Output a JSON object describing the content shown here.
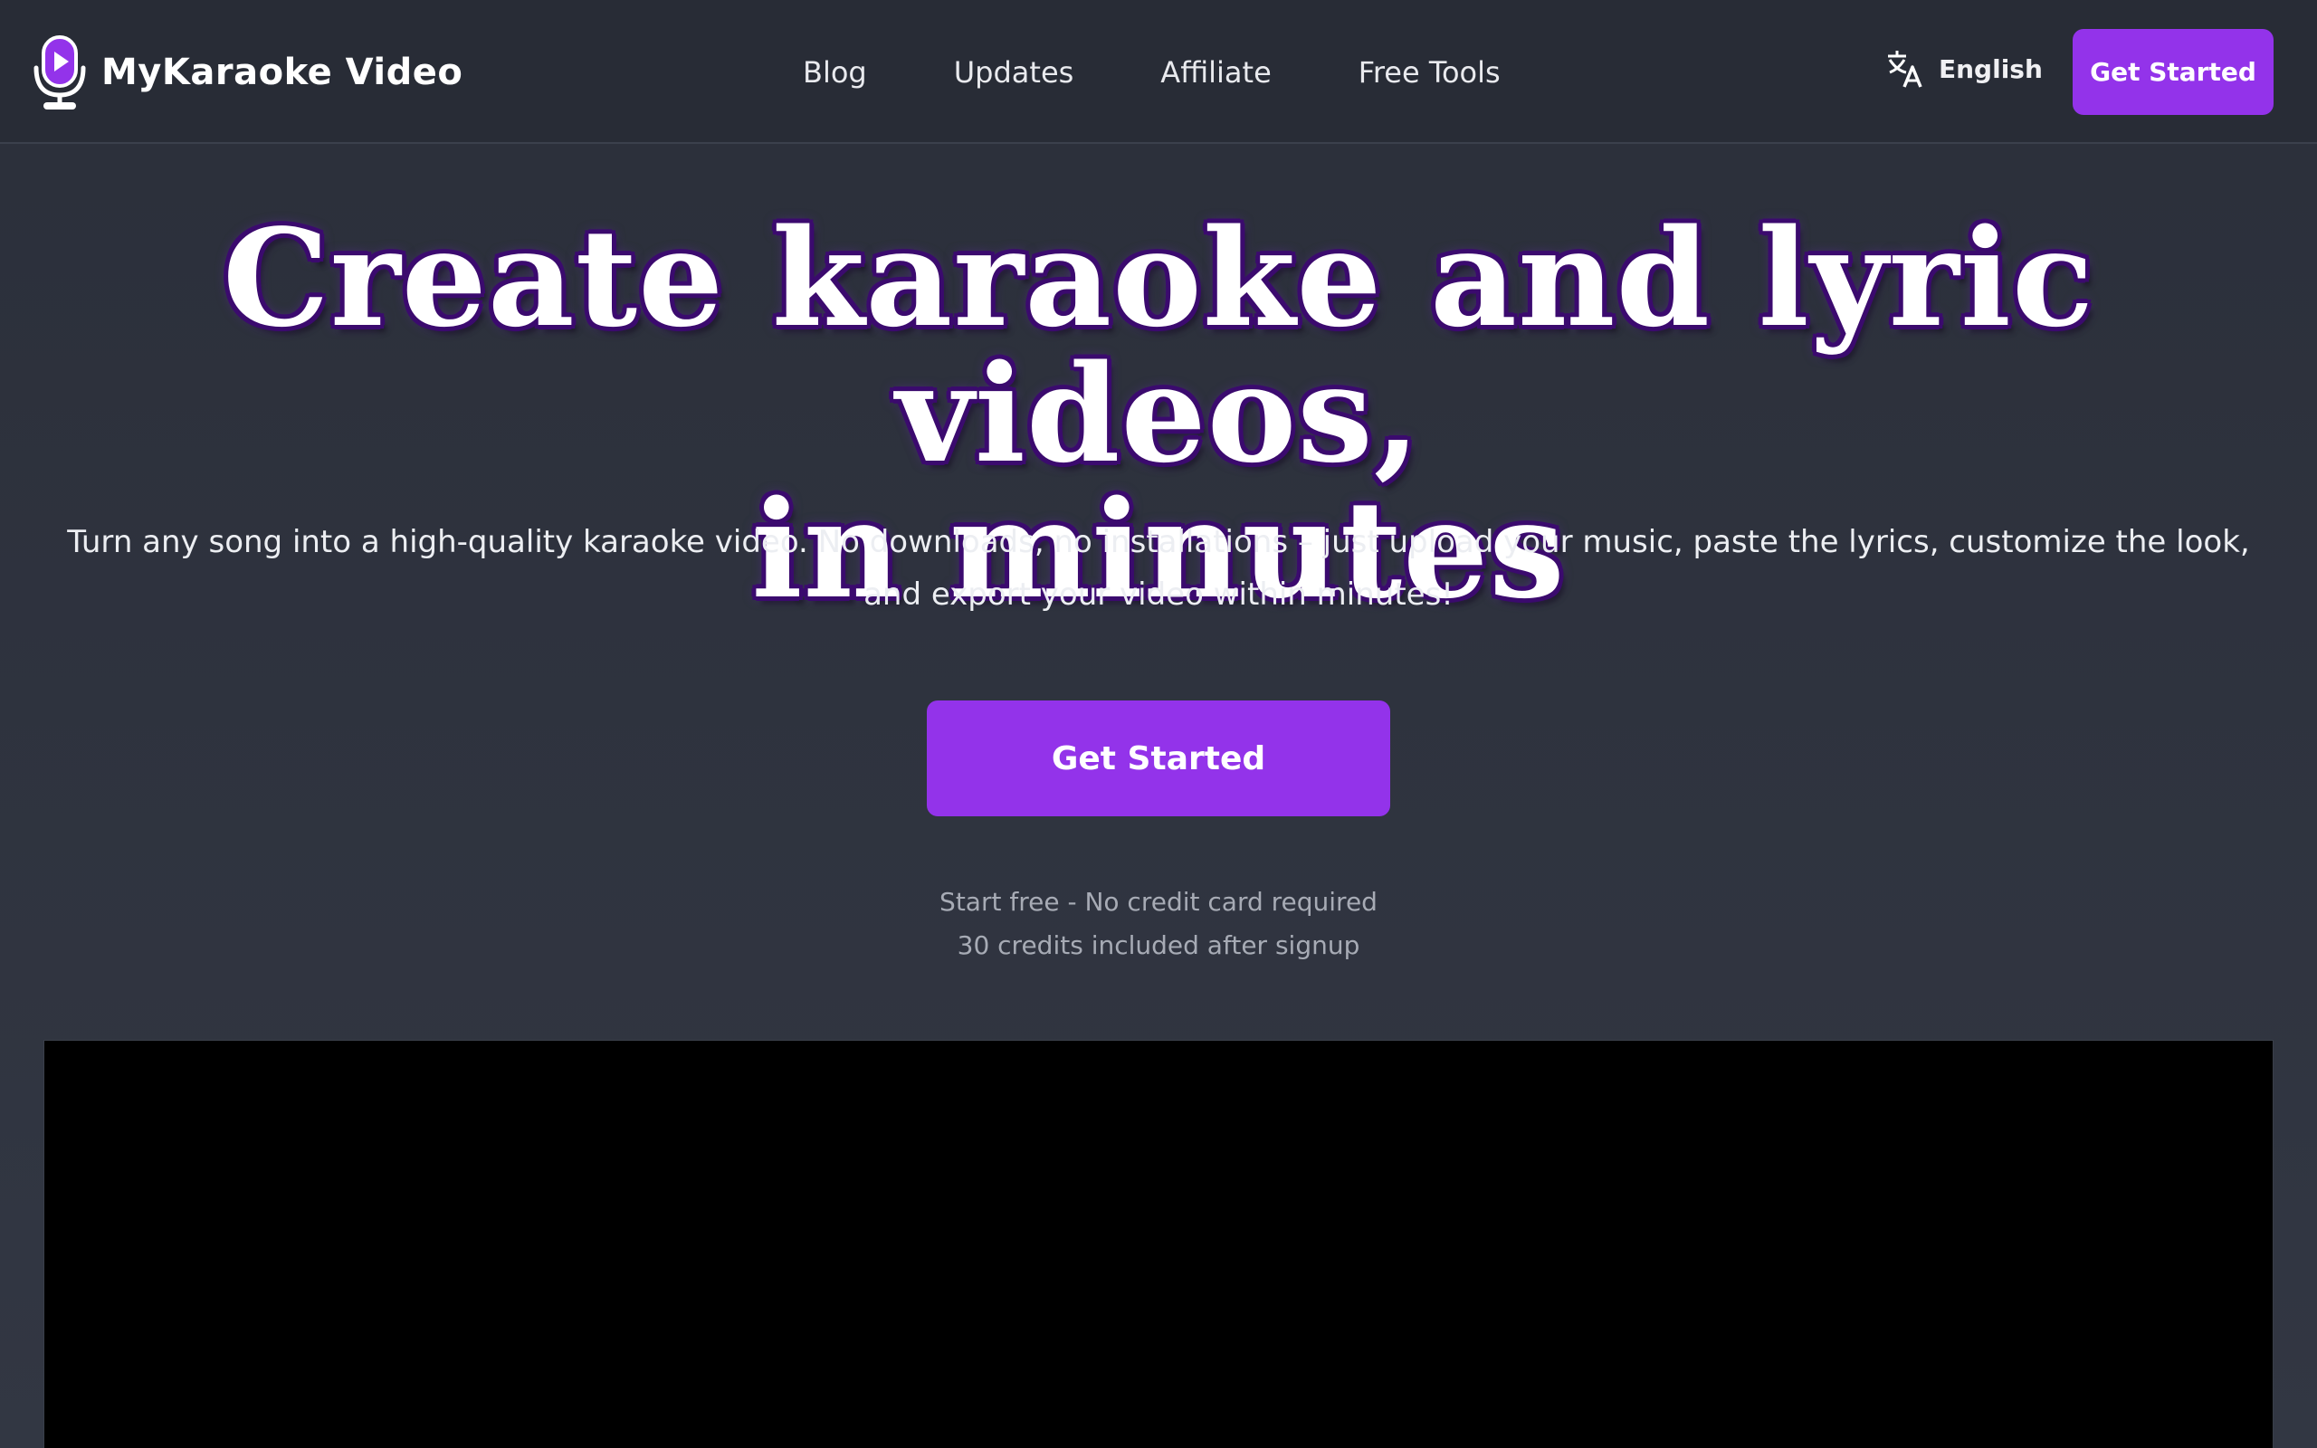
{
  "brand": {
    "name": "MyKaraoke Video",
    "icon": "microphone-play-icon",
    "accent": "#9333ea"
  },
  "nav": {
    "links": [
      "Blog",
      "Updates",
      "Affiliate",
      "Free Tools"
    ]
  },
  "language": {
    "icon": "translate-icon",
    "label": "English"
  },
  "header_cta": {
    "label": "Get Started"
  },
  "hero": {
    "title_line1": "Create karaoke and lyric videos,",
    "title_line2": "in minutes",
    "subtitle": "Turn any song into a high-quality karaoke video. No downloads, no installations – just upload your music, paste the lyrics, customize the look, and export your video within minutes!",
    "cta_label": "Get Started",
    "note_line1": "Start free - No credit card required",
    "note_line2": "30 credits included after signup"
  },
  "colors": {
    "background": "#2b2f3a",
    "navbar": "#282c36",
    "button": "#9333ea",
    "title_outline": "#3b0a6e",
    "video_bg": "#000000"
  }
}
